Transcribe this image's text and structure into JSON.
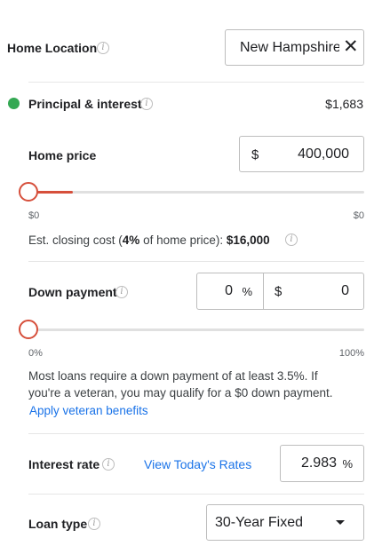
{
  "home_location": {
    "label": "Home Location",
    "value": "New Hampshire"
  },
  "principal": {
    "label": "Principal & interest",
    "amount": "$1,683",
    "dot_color": "#34a853"
  },
  "home_price": {
    "label": "Home price",
    "currency": "$",
    "value": "400,000",
    "slider_min": "$0",
    "slider_max": "$0",
    "slider_level": 0.01,
    "closing_prefix": "Est. closing cost (",
    "closing_pct": "4%",
    "closing_mid": " of home price): ",
    "closing_value": "$16,000"
  },
  "down_payment": {
    "label": "Down payment",
    "percent_value": "0",
    "percent_unit": "%",
    "currency": "$",
    "amount_value": "0",
    "slider_min": "0%",
    "slider_max": "100%",
    "slider_level": 0,
    "note_line1": "Most loans require a down payment of at least 3.5%. If",
    "note_line2": "you're a veteran, you may qualify for a $0 down payment.",
    "veteran_link": "Apply veteran benefits"
  },
  "interest": {
    "label": "Interest rate",
    "rates_link": "View Today's Rates",
    "value": "2.983",
    "unit": "%"
  },
  "loan_type": {
    "label": "Loan type",
    "selected": "30-Year Fixed"
  },
  "colors": {
    "accent": "#d64f3b",
    "link": "#1a73e8"
  }
}
